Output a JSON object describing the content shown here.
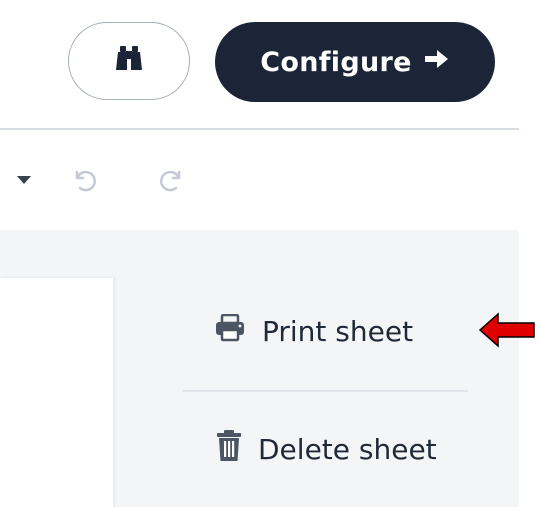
{
  "header": {
    "search_icon": "binoculars-icon",
    "configure_label": "Configure",
    "configure_icon": "arrow-right-icon"
  },
  "edit_toolbar": {
    "dropdown_icon": "caret-down-icon",
    "undo_icon": "undo-icon",
    "redo_icon": "redo-icon"
  },
  "sheet_menu": {
    "items": [
      {
        "label": "Print sheet",
        "icon": "printer-icon"
      },
      {
        "label": "Delete sheet",
        "icon": "trash-icon"
      }
    ]
  },
  "annotation": {
    "arrow_color": "#e00000",
    "arrow_icon": "red-arrow-pointer"
  },
  "colors": {
    "primary_dark": "#1b2537",
    "text": "#1f2937",
    "muted_icon": "#c5cad2",
    "menu_icon": "#4b5563"
  }
}
